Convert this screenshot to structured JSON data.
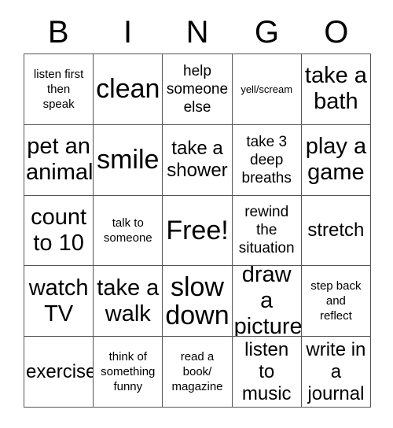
{
  "header": {
    "letters": [
      "B",
      "I",
      "N",
      "G",
      "O"
    ]
  },
  "grid": {
    "rows": 5,
    "columns": 5,
    "border_color": "#555555",
    "background_color": "#ffffff",
    "text_color": "#000000",
    "cells": [
      {
        "text": "listen first\nthen\nspeak",
        "size": "s-xs"
      },
      {
        "text": "clean",
        "size": "s-xl"
      },
      {
        "text": "help\nsomeone\nelse",
        "size": "s-sm"
      },
      {
        "text": "yell/scream",
        "size": "s-xxs"
      },
      {
        "text": "take a\nbath",
        "size": "s-lg"
      },
      {
        "text": "pet an\nanimal",
        "size": "s-lg"
      },
      {
        "text": "smile",
        "size": "s-xl"
      },
      {
        "text": "take a\nshower",
        "size": "s-md"
      },
      {
        "text": "take 3\ndeep\nbreaths",
        "size": "s-sm"
      },
      {
        "text": "play a\ngame",
        "size": "s-lg"
      },
      {
        "text": "count\nto 10",
        "size": "s-lg"
      },
      {
        "text": "talk to\nsomeone",
        "size": "s-xs"
      },
      {
        "text": "Free!",
        "size": "s-xl"
      },
      {
        "text": "rewind\nthe\nsituation",
        "size": "s-sm"
      },
      {
        "text": "stretch",
        "size": "s-md"
      },
      {
        "text": "watch\nTV",
        "size": "s-lg"
      },
      {
        "text": "take a\nwalk",
        "size": "s-lg"
      },
      {
        "text": "slow\ndown",
        "size": "s-xl"
      },
      {
        "text": "draw a\npicture",
        "size": "s-lg"
      },
      {
        "text": "step back\nand\nreflect",
        "size": "s-xs"
      },
      {
        "text": "exercise",
        "size": "s-md"
      },
      {
        "text": "think of\nsomething\nfunny",
        "size": "s-xs"
      },
      {
        "text": "read a\nbook/\nmagazine",
        "size": "s-xs"
      },
      {
        "text": "listen\nto\nmusic",
        "size": "s-md"
      },
      {
        "text": "write in\na\njournal",
        "size": "s-md"
      }
    ]
  }
}
